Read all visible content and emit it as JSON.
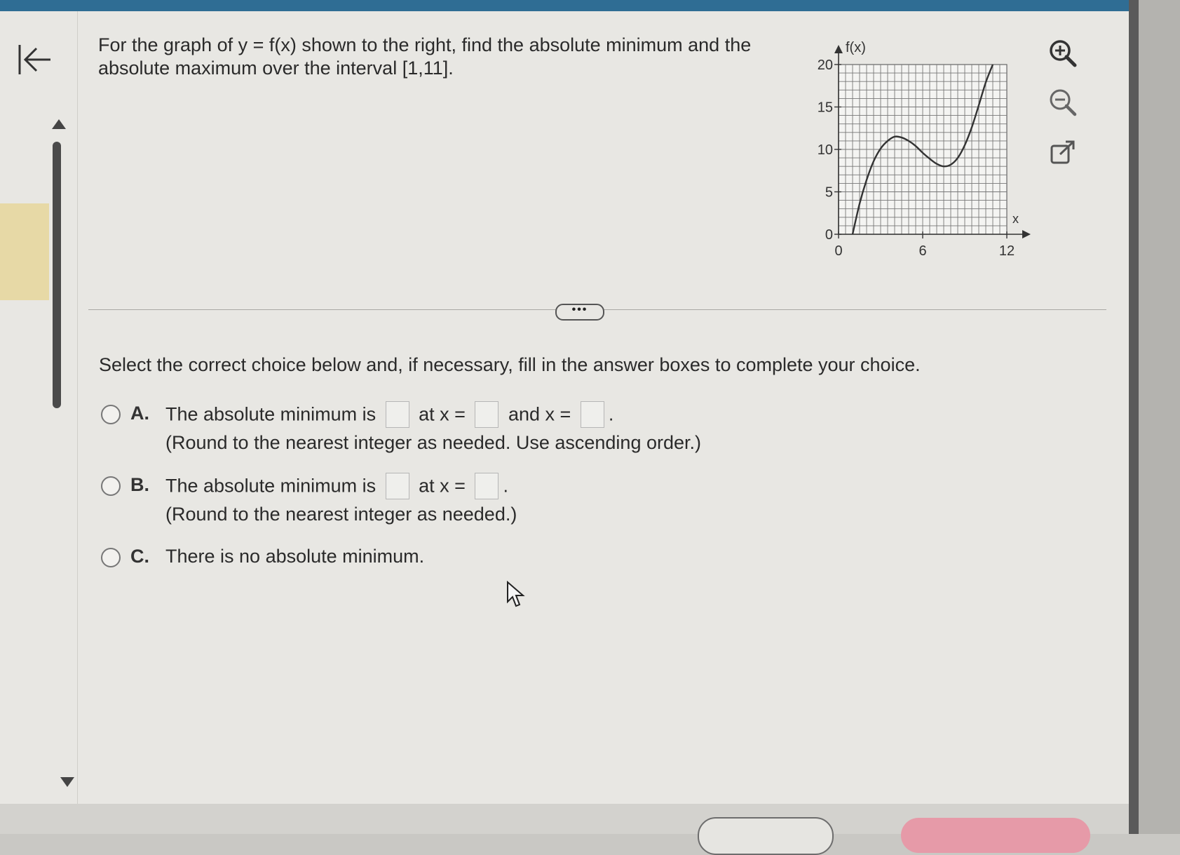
{
  "question": {
    "line1": "For the graph of y = f(x) shown to the right, find the absolute minimum and the",
    "line2": "absolute maximum over the interval [1,11]."
  },
  "graph": {
    "y_axis_label": "f(x)",
    "x_axis_label": "x",
    "y_ticks": [
      "20",
      "15",
      "10",
      "5",
      "0"
    ],
    "x_ticks": [
      "0",
      "6",
      "12"
    ],
    "curve_color": "#333333"
  },
  "chart_data": {
    "type": "line",
    "title": "",
    "xlabel": "x",
    "ylabel": "f(x)",
    "xlim": [
      0,
      12
    ],
    "ylim": [
      0,
      20
    ],
    "grid": true,
    "series": [
      {
        "x": [
          1,
          1.5,
          2,
          2.5,
          3,
          3.5,
          4,
          4.5,
          5,
          5.5,
          6,
          6.5,
          7,
          7.5,
          8,
          8.5,
          9,
          9.5,
          10,
          10.5,
          11
        ],
        "y": [
          0,
          3.6,
          6.4,
          8.6,
          10.1,
          11.0,
          11.5,
          11.4,
          11.0,
          10.4,
          9.6,
          8.9,
          8.3,
          8.0,
          8.2,
          9.0,
          10.5,
          12.6,
          15.2,
          17.9,
          20.0
        ]
      }
    ]
  },
  "tools": {
    "zoom_in": "zoom-in-icon",
    "zoom_out": "zoom-out-icon",
    "popout": "popout-icon"
  },
  "more_label": "•••",
  "instruction": "Select the correct choice below and, if necessary, fill in the answer boxes to complete your choice.",
  "choices": {
    "a": {
      "letter": "A.",
      "text1": "The absolute minimum is",
      "text2": "at x =",
      "text3": "and x =",
      "end": ".",
      "note": "(Round to the nearest integer as needed. Use ascending order.)"
    },
    "b": {
      "letter": "B.",
      "text1": "The absolute minimum is",
      "text2": "at x =",
      "end": ".",
      "note": "(Round to the nearest integer as needed.)"
    },
    "c": {
      "letter": "C.",
      "text1": "There is no absolute minimum."
    }
  }
}
